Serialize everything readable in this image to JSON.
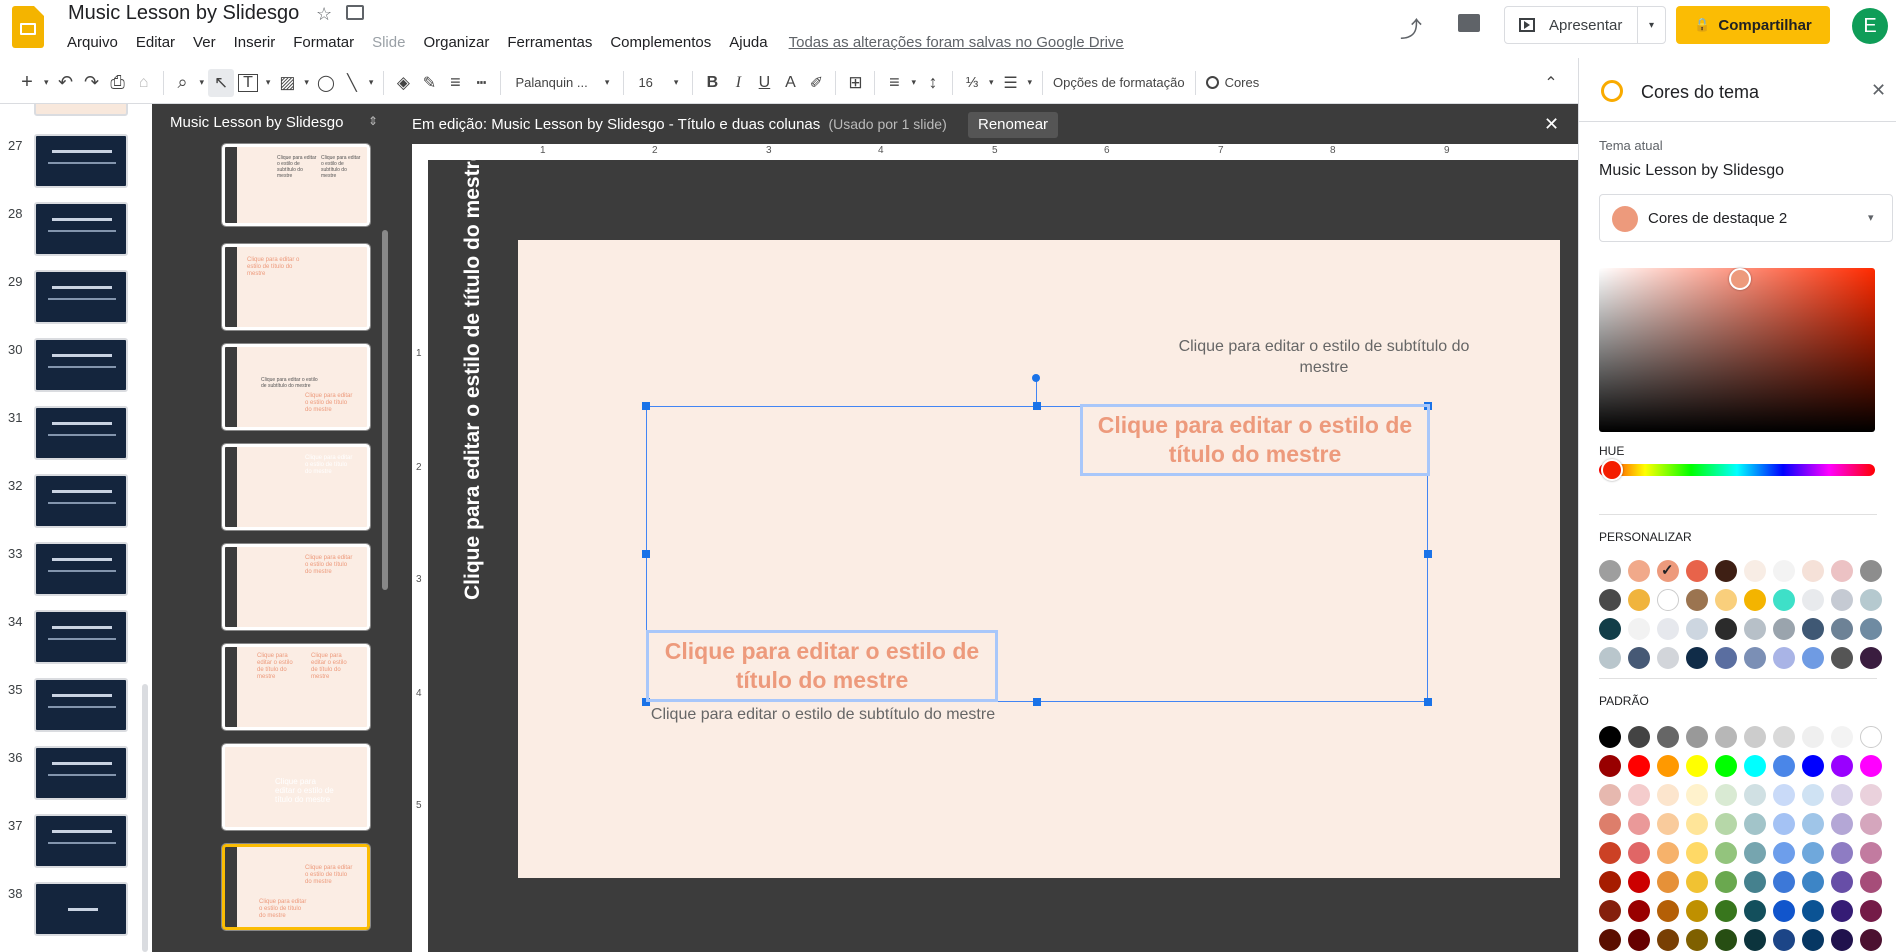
{
  "header": {
    "doc_title": "Music Lesson by Slidesgo",
    "star": "☆",
    "menu": [
      "Arquivo",
      "Editar",
      "Ver",
      "Inserir",
      "Formatar",
      "Slide",
      "Organizar",
      "Ferramentas",
      "Complementos",
      "Ajuda"
    ],
    "saved_status": "Todas as alterações foram salvas no Google Drive",
    "present_label": "Apresentar",
    "share_label": "Compartilhar",
    "share_icon": "🔒",
    "avatar_initial": "E",
    "trend_icon": "⤴"
  },
  "toolbar": {
    "plus": "+",
    "undo": "↶",
    "redo": "↷",
    "print": "⎙",
    "paint": "⌂",
    "zoom": "⌕",
    "cursor": "↖",
    "textbox": "T",
    "image": "▨",
    "shape": "◯",
    "line": "╲",
    "fill": "◈",
    "pen": "✎",
    "border_weight": "≡",
    "border_dash": "┅",
    "font_name": "Palanquin ...",
    "font_size": "16",
    "bold": "B",
    "italic": "I",
    "underline": "U",
    "text_color": "A",
    "highlight": "✐",
    "insert_link": "⊞",
    "align": "≡",
    "line_spacing": "↕",
    "numbered_list": "⅓",
    "bullet_list": "☰",
    "format_options": "Opções de formatação",
    "colors_label": "Cores",
    "caret": "▾",
    "collapse": "⌃"
  },
  "slides": {
    "numbers": [
      "27",
      "28",
      "29",
      "30",
      "31",
      "32",
      "33",
      "34",
      "35",
      "36",
      "37",
      "38"
    ]
  },
  "layouts": {
    "header": "Music Lesson by Slidesgo",
    "sort": "⇕",
    "thumb_title": "Clique para editar o estilo de título do mestre",
    "thumb_sub": "Clique para editar o estilo de subtítulo do mestre"
  },
  "editor": {
    "editing_label": "Em edição: Music Lesson by Slidesgo - Título e duas colunas",
    "used_label": "(Usado por 1 slide)",
    "rename_label": "Renomear",
    "close": "✕",
    "ruler_top": [
      "1",
      "2",
      "3",
      "4",
      "5",
      "6",
      "7",
      "8",
      "9"
    ],
    "ruler_left": [
      "1",
      "2",
      "3",
      "4",
      "5"
    ]
  },
  "slide": {
    "vertical_title": "Clique para editar o estilo de título do mestre",
    "subtitle_1": "Clique para editar o estilo de subtítulo do mestre",
    "title_1": "Clique para editar o estilo de título do mestre",
    "title_2": "Clique para editar o estilo de título do mestre",
    "subtitle_2": "Clique para editar o estilo de subtítulo do mestre"
  },
  "panel": {
    "title": "Cores do tema",
    "close": "✕",
    "current_theme_label": "Tema atual",
    "current_theme_name": "Music Lesson by Slidesgo",
    "selected_color_label": "Cores de destaque 2",
    "selected_color": "#ed9a7c",
    "caret": "▾",
    "hue_label": "HUE",
    "custom_label": "PERSONALIZAR",
    "standard_label": "PADRÃO",
    "custom_colors": [
      "#9e9e9e",
      "#f1a98a",
      "#ed9a7c",
      "#e8634a",
      "#3e1f14",
      "#f8ede5",
      "#f3f3f3",
      "#f5e1d8",
      "#ecc2c4",
      "#8d8d8d",
      "#4a4a4a",
      "#f0b43d",
      "#ffffff",
      "#9b7450",
      "#f9cf7c",
      "#f4b400",
      "#3ee0c8",
      "#e8eaed",
      "#c5cad3",
      "#b5c9cf",
      "#123d48",
      "#f2f2f2",
      "#e6e8ed",
      "#cdd6e0",
      "#2b2b2b",
      "#b7c0c8",
      "#9aa4ad",
      "#3f5874",
      "#6d8296",
      "#6f8ba2",
      "#b9c6cc",
      "#465975",
      "#d2d5da",
      "#102c48",
      "#5a6ea0",
      "#7b8fb5",
      "#a9b4e6",
      "#6f9be3",
      "#555555",
      "#3a1d3f"
    ],
    "custom_checked_index": 2,
    "standard_colors": [
      "#000000",
      "#434343",
      "#666666",
      "#999999",
      "#b7b7b7",
      "#cccccc",
      "#d9d9d9",
      "#efefef",
      "#f3f3f3",
      "#ffffff",
      "#980000",
      "#ff0000",
      "#ff9900",
      "#ffff00",
      "#00ff00",
      "#00ffff",
      "#4a86e8",
      "#0000ff",
      "#9900ff",
      "#ff00ff",
      "#e6b8af",
      "#f4cccc",
      "#fce5cd",
      "#fff2cc",
      "#d9ead3",
      "#d0e0e3",
      "#c9daf8",
      "#cfe2f3",
      "#d9d2e9",
      "#ead1dc",
      "#dd7e6b",
      "#ea9999",
      "#f9cb9c",
      "#ffe599",
      "#b6d7a8",
      "#a2c4c9",
      "#a4c2f4",
      "#9fc5e8",
      "#b4a7d6",
      "#d5a6bd",
      "#cc4125",
      "#e06666",
      "#f6b26b",
      "#ffd966",
      "#93c47d",
      "#76a5af",
      "#6d9eeb",
      "#6fa8dc",
      "#8e7cc3",
      "#c27ba0",
      "#a61c00",
      "#cc0000",
      "#e69138",
      "#f1c232",
      "#6aa84f",
      "#45818e",
      "#3c78d8",
      "#3d85c6",
      "#674ea7",
      "#a64d79",
      "#85200c",
      "#990000",
      "#b45f06",
      "#bf9000",
      "#38761d",
      "#134f5c",
      "#1155cc",
      "#0b5394",
      "#351c75",
      "#741b47",
      "#5b0f00",
      "#660000",
      "#783f04",
      "#7f6000",
      "#274e13",
      "#0c343d",
      "#1c4587",
      "#073763",
      "#20124d",
      "#4c1130"
    ]
  }
}
